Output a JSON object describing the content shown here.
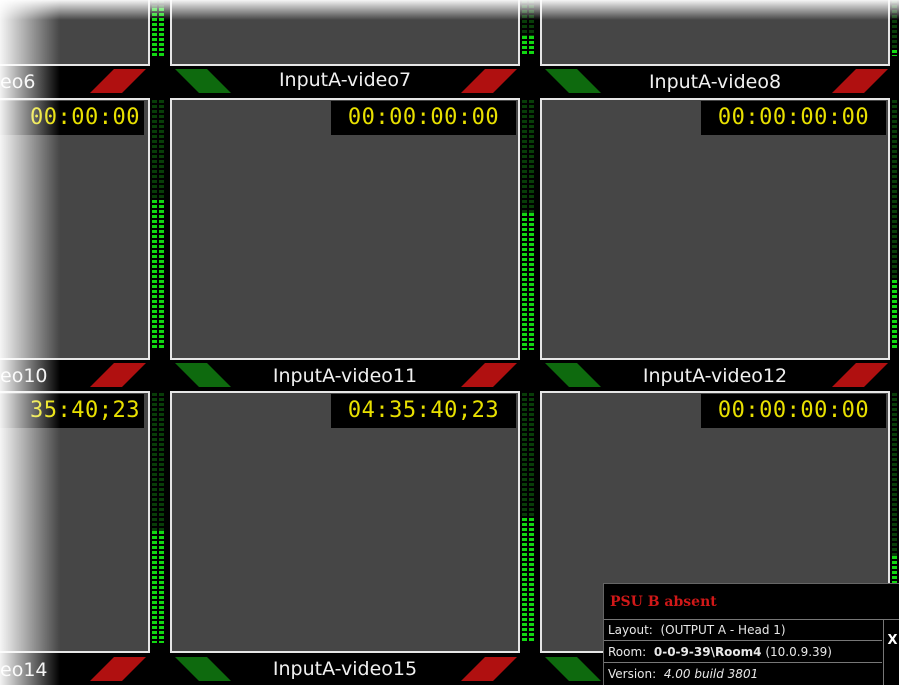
{
  "tiles": [
    {
      "label": "eo6",
      "timecode": ""
    },
    {
      "label": "InputA-video7",
      "timecode": ""
    },
    {
      "label": "InputA-video8",
      "timecode": ""
    },
    {
      "label": "eo10",
      "timecode": "00:00:00"
    },
    {
      "label": "InputA-video11",
      "timecode": "00:00:00:00"
    },
    {
      "label": "InputA-video12",
      "timecode": "00:00:00:00"
    },
    {
      "label": "eo14",
      "timecode": "35:40;23"
    },
    {
      "label": "InputA-video15",
      "timecode": "04:35:40;23"
    },
    {
      "label": "",
      "timecode": "00:00:00:00"
    }
  ],
  "meters": [
    {
      "levels": [
        0.85,
        0.85
      ]
    },
    {
      "levels": [
        0.35,
        0.35
      ]
    },
    {
      "levels": [
        0.1,
        0.1
      ]
    },
    {
      "levels": [
        0.6,
        0.6
      ]
    },
    {
      "levels": [
        0.55,
        0.55
      ]
    },
    {
      "levels": [
        0.28,
        0.28
      ]
    },
    {
      "levels": [
        0.45,
        0.45
      ]
    },
    {
      "levels": [
        0.5,
        0.5
      ]
    },
    {
      "levels": [
        0.35,
        0.35
      ]
    }
  ],
  "status": {
    "alert": "PSU B absent",
    "layout_label": "Layout:",
    "layout_value": "(OUTPUT A - Head 1)",
    "room_label": "Room:",
    "room_path": "0-0-9-39\\",
    "room_name": "Room4",
    "room_ip": "(10.0.9.39)",
    "version_label": "Version:",
    "version_value": "4.00 build 3801",
    "close_label": "X"
  },
  "colors": {
    "tally_green": "#0e6a0e",
    "tally_red": "#b01010",
    "timecode_yellow": "#e8e000",
    "meter_green": "#12d812",
    "alert_red": "#d01818"
  }
}
